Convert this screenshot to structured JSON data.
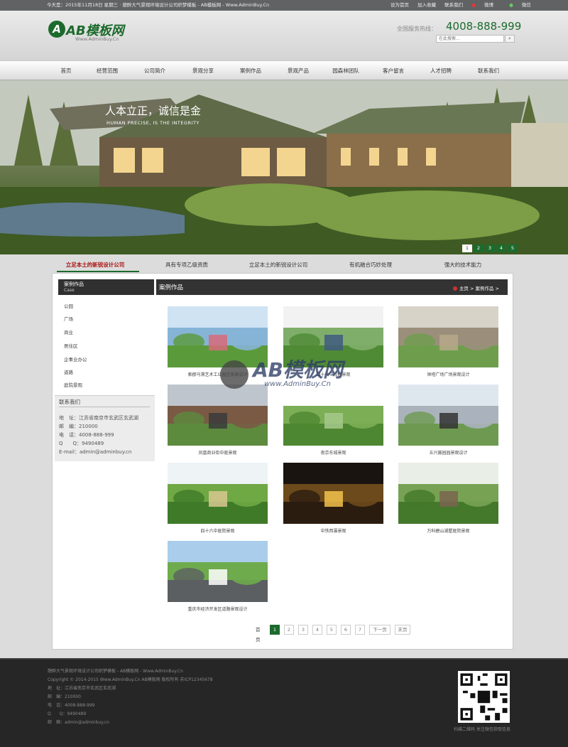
{
  "topbar": {
    "left": "今天是：2015年11月18日 星期三 · 憩醉大气景观环境设计公司织梦模板 - AB模板网 - Www.AdminBuy.Cn",
    "links": [
      "设为首页",
      "加入收藏",
      "联系我们",
      "微博",
      "微信"
    ]
  },
  "header": {
    "logo_letter": "A",
    "logo_text": "AB模板网",
    "logo_sub": "Www.AdminBuy.Cn",
    "hotline_label": "全国服务热线：",
    "hotline_number": "4008-888-999",
    "search_placeholder": "在此搜索...",
    "search_button": "⌕"
  },
  "nav": [
    "首页",
    "经营范围",
    "公司简介",
    "景观分享",
    "案例作品",
    "景观产品",
    "园森林团队",
    "客户留言",
    "人才招聘",
    "联系我们"
  ],
  "banner": {
    "title": "人本立正，诚信是金",
    "subtitle": "HUMAN PRECISE, IS THE INTEGRITY",
    "pages": [
      "1",
      "2",
      "3",
      "4",
      "5"
    ],
    "active_page": 1
  },
  "tabs": [
    "立足本土的新锐设计公司",
    "具有专项乙级资质",
    "立足本土的新锐设计公司",
    "有机融合巧妙处理",
    "强大的技术能力"
  ],
  "sidebar": {
    "title": "案例作品",
    "title_en": "Case",
    "items": [
      "公园",
      "广场",
      "商业",
      "居住区",
      "企事业办公",
      "道路",
      "庭院景观"
    ]
  },
  "contact": {
    "title": "联系我们",
    "lines": [
      "地　址：江苏省南京市玄武区玄武湖",
      "邮　编：210000",
      "电　话：4008-888-999",
      "Q　　Q：9490489",
      "E-mail：admin@adminbuy.cn"
    ]
  },
  "main": {
    "title": "案例作品",
    "crumb": "主页 > 案例作品 >"
  },
  "cases": [
    {
      "caption": "索郡乌溯艺术工业园区景观设计",
      "theme": "plaza"
    },
    {
      "caption": "四十六中校园景观",
      "theme": "campus"
    },
    {
      "caption": "钟塔广场广场景观设计",
      "theme": "tower"
    },
    {
      "caption": "凤凰商业街中庭景观",
      "theme": "street"
    },
    {
      "caption": "南京东城景观",
      "theme": "aerial"
    },
    {
      "caption": "五兴酱园园景观设计",
      "theme": "roof"
    },
    {
      "caption": "四十六中庭院景观",
      "theme": "garden"
    },
    {
      "caption": "中铁西瀛景观",
      "theme": "night"
    },
    {
      "caption": "万科碧山湖墅庭院景观",
      "theme": "pavilion"
    },
    {
      "caption": "重庆市经济开发区道路景观设计",
      "theme": "road"
    }
  ],
  "pagination": {
    "first": "首页",
    "pages": [
      "1",
      "2",
      "3",
      "4",
      "5",
      "6",
      "7"
    ],
    "next": "下一页",
    "last": "末页"
  },
  "watermark": {
    "big": "AB模板网",
    "small": "www.AdminBuy.Cn"
  },
  "footer": {
    "lines": [
      "憩醉大气景观环境设计公司织梦模板 - AB模板网 - Www.AdminBuy.Cn",
      "Copyright © 2014-2015 Www.AdminBuy.Cn AB模板网 版权所有  苏ICP12345678",
      "地　址：江苏省南京市玄武区玄武湖",
      "邮　编：210000",
      "电　话：4008-888-999",
      "Q　　Q：9490489",
      "邮　箱：admin@adminbuy.cn"
    ],
    "qr_caption": "扫描二维码 关注微信获取信息"
  },
  "colors": {
    "brand": "#1c6b2d",
    "accent": "#aa1111",
    "dark": "#333333"
  }
}
